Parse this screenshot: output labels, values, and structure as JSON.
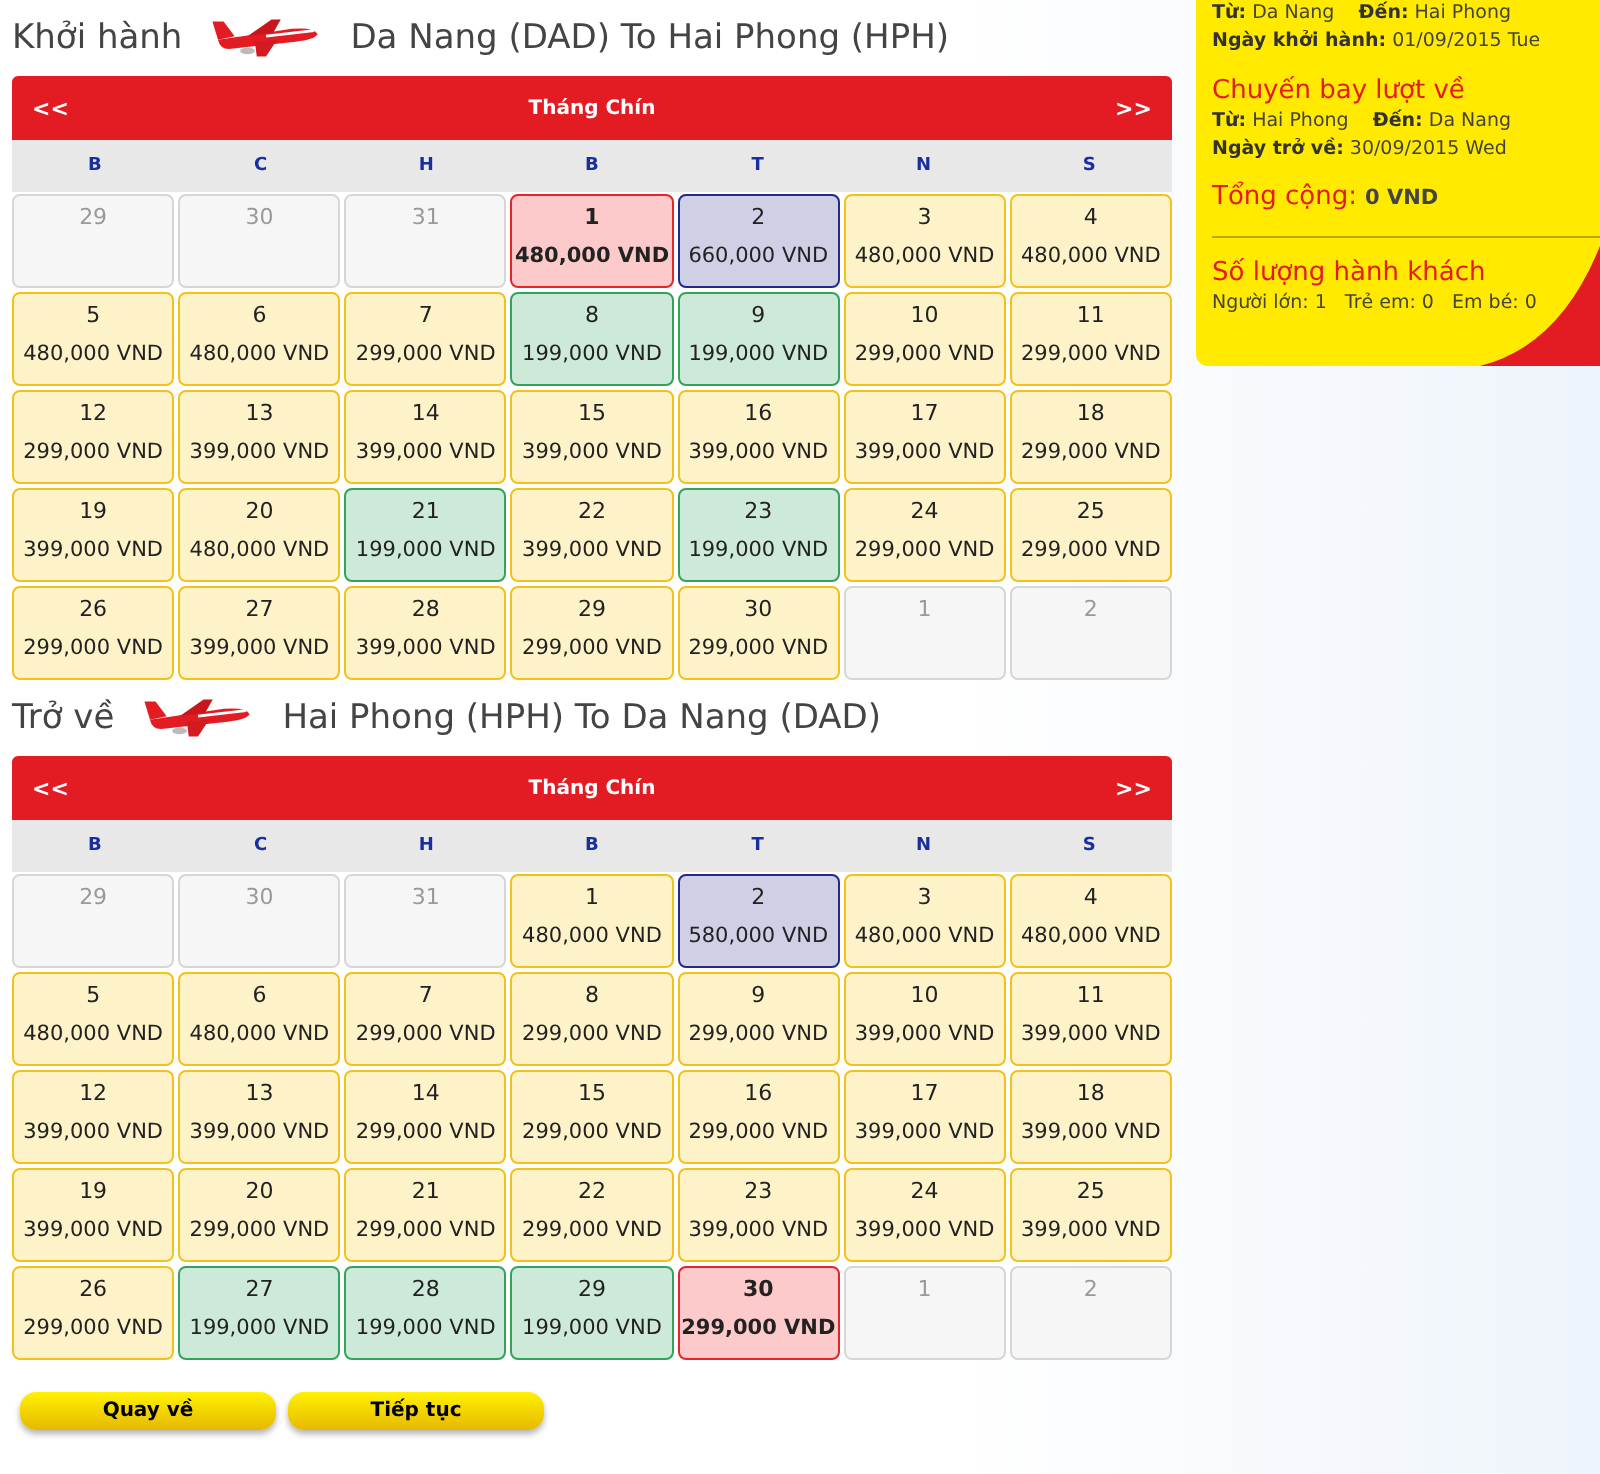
{
  "calendars": [
    {
      "title": "Khởi hành",
      "route": "Da Nang (DAD) To Hai Phong (HPH)",
      "prev": "<<",
      "month": "Tháng Chín",
      "next": ">>",
      "weekdays": [
        "B",
        "C",
        "H",
        "B",
        "T",
        "N",
        "S"
      ],
      "days": [
        {
          "day": "29",
          "kind": "out"
        },
        {
          "day": "30",
          "kind": "out"
        },
        {
          "day": "31",
          "kind": "out"
        },
        {
          "day": "1",
          "price": "480,000 VND",
          "kind": "selected"
        },
        {
          "day": "2",
          "price": "660,000 VND",
          "kind": "peak"
        },
        {
          "day": "3",
          "price": "480,000 VND",
          "kind": "normal"
        },
        {
          "day": "4",
          "price": "480,000 VND",
          "kind": "normal"
        },
        {
          "day": "5",
          "price": "480,000 VND",
          "kind": "normal"
        },
        {
          "day": "6",
          "price": "480,000 VND",
          "kind": "normal"
        },
        {
          "day": "7",
          "price": "299,000 VND",
          "kind": "normal"
        },
        {
          "day": "8",
          "price": "199,000 VND",
          "kind": "cheap"
        },
        {
          "day": "9",
          "price": "199,000 VND",
          "kind": "cheap"
        },
        {
          "day": "10",
          "price": "299,000 VND",
          "kind": "normal"
        },
        {
          "day": "11",
          "price": "299,000 VND",
          "kind": "normal"
        },
        {
          "day": "12",
          "price": "299,000 VND",
          "kind": "normal"
        },
        {
          "day": "13",
          "price": "399,000 VND",
          "kind": "normal"
        },
        {
          "day": "14",
          "price": "399,000 VND",
          "kind": "normal"
        },
        {
          "day": "15",
          "price": "399,000 VND",
          "kind": "normal"
        },
        {
          "day": "16",
          "price": "399,000 VND",
          "kind": "normal"
        },
        {
          "day": "17",
          "price": "399,000 VND",
          "kind": "normal"
        },
        {
          "day": "18",
          "price": "299,000 VND",
          "kind": "normal"
        },
        {
          "day": "19",
          "price": "399,000 VND",
          "kind": "normal"
        },
        {
          "day": "20",
          "price": "480,000 VND",
          "kind": "normal"
        },
        {
          "day": "21",
          "price": "199,000 VND",
          "kind": "cheap"
        },
        {
          "day": "22",
          "price": "399,000 VND",
          "kind": "normal"
        },
        {
          "day": "23",
          "price": "199,000 VND",
          "kind": "cheap"
        },
        {
          "day": "24",
          "price": "299,000 VND",
          "kind": "normal"
        },
        {
          "day": "25",
          "price": "299,000 VND",
          "kind": "normal"
        },
        {
          "day": "26",
          "price": "299,000 VND",
          "kind": "normal"
        },
        {
          "day": "27",
          "price": "399,000 VND",
          "kind": "normal"
        },
        {
          "day": "28",
          "price": "399,000 VND",
          "kind": "normal"
        },
        {
          "day": "29",
          "price": "299,000 VND",
          "kind": "normal"
        },
        {
          "day": "30",
          "price": "299,000 VND",
          "kind": "normal"
        },
        {
          "day": "1",
          "kind": "out"
        },
        {
          "day": "2",
          "kind": "out"
        }
      ]
    },
    {
      "title": "Trở về",
      "route": "Hai Phong (HPH) To Da Nang (DAD)",
      "prev": "<<",
      "month": "Tháng Chín",
      "next": ">>",
      "weekdays": [
        "B",
        "C",
        "H",
        "B",
        "T",
        "N",
        "S"
      ],
      "days": [
        {
          "day": "29",
          "kind": "out"
        },
        {
          "day": "30",
          "kind": "out"
        },
        {
          "day": "31",
          "kind": "out"
        },
        {
          "day": "1",
          "price": "480,000 VND",
          "kind": "normal"
        },
        {
          "day": "2",
          "price": "580,000 VND",
          "kind": "peak"
        },
        {
          "day": "3",
          "price": "480,000 VND",
          "kind": "normal"
        },
        {
          "day": "4",
          "price": "480,000 VND",
          "kind": "normal"
        },
        {
          "day": "5",
          "price": "480,000 VND",
          "kind": "normal"
        },
        {
          "day": "6",
          "price": "480,000 VND",
          "kind": "normal"
        },
        {
          "day": "7",
          "price": "299,000 VND",
          "kind": "normal"
        },
        {
          "day": "8",
          "price": "299,000 VND",
          "kind": "normal"
        },
        {
          "day": "9",
          "price": "299,000 VND",
          "kind": "normal"
        },
        {
          "day": "10",
          "price": "399,000 VND",
          "kind": "normal"
        },
        {
          "day": "11",
          "price": "399,000 VND",
          "kind": "normal"
        },
        {
          "day": "12",
          "price": "399,000 VND",
          "kind": "normal"
        },
        {
          "day": "13",
          "price": "399,000 VND",
          "kind": "normal"
        },
        {
          "day": "14",
          "price": "299,000 VND",
          "kind": "normal"
        },
        {
          "day": "15",
          "price": "299,000 VND",
          "kind": "normal"
        },
        {
          "day": "16",
          "price": "299,000 VND",
          "kind": "normal"
        },
        {
          "day": "17",
          "price": "399,000 VND",
          "kind": "normal"
        },
        {
          "day": "18",
          "price": "399,000 VND",
          "kind": "normal"
        },
        {
          "day": "19",
          "price": "399,000 VND",
          "kind": "normal"
        },
        {
          "day": "20",
          "price": "299,000 VND",
          "kind": "normal"
        },
        {
          "day": "21",
          "price": "299,000 VND",
          "kind": "normal"
        },
        {
          "day": "22",
          "price": "299,000 VND",
          "kind": "normal"
        },
        {
          "day": "23",
          "price": "399,000 VND",
          "kind": "normal"
        },
        {
          "day": "24",
          "price": "399,000 VND",
          "kind": "normal"
        },
        {
          "day": "25",
          "price": "399,000 VND",
          "kind": "normal"
        },
        {
          "day": "26",
          "price": "299,000 VND",
          "kind": "normal"
        },
        {
          "day": "27",
          "price": "199,000 VND",
          "kind": "cheap"
        },
        {
          "day": "28",
          "price": "199,000 VND",
          "kind": "cheap"
        },
        {
          "day": "29",
          "price": "199,000 VND",
          "kind": "cheap"
        },
        {
          "day": "30",
          "price": "299,000 VND",
          "kind": "selected"
        },
        {
          "day": "1",
          "kind": "out"
        },
        {
          "day": "2",
          "kind": "out"
        }
      ]
    }
  ],
  "buttons": [
    "Quay về",
    "Tiếp tục"
  ],
  "summary": {
    "outbound_lines": [
      "**Từ:** Da Nang    **Đến:** Hai Phong",
      "**Ngày khởi hành:** 01/09/2015 Tue"
    ],
    "return_title": "Chuyến bay lượt về",
    "return_lines": [
      "**Từ:** Hai Phong    **Đến:** Da Nang",
      "**Ngày trở về:** 30/09/2015 Wed"
    ],
    "total_label": "Tổng cộng:",
    "total": "0 VND",
    "passengers_title": "Số lượng hành khách",
    "passengers": "Người lớn: 1   Trẻ em: 0   Em bé: 0"
  }
}
